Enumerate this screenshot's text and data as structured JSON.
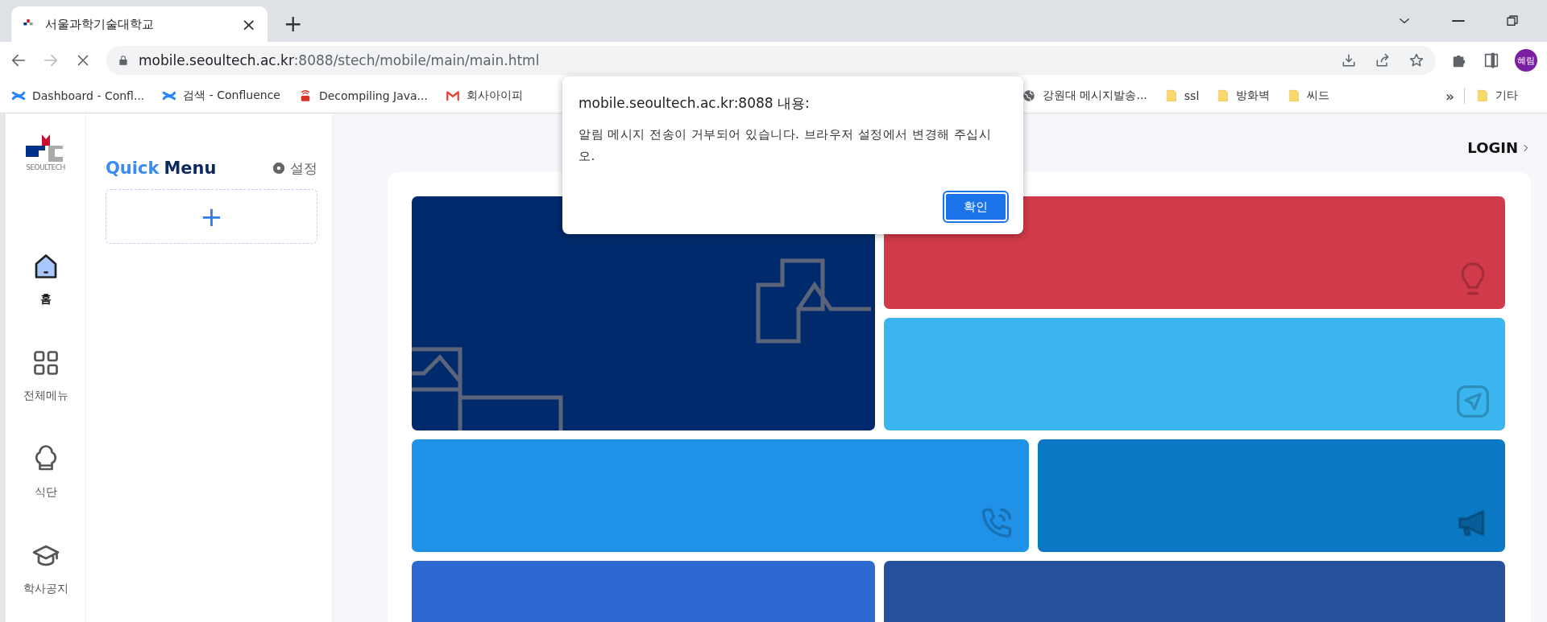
{
  "browser": {
    "tab": {
      "title": "서울과학기술대학교",
      "close": "×"
    },
    "new_tab": "+",
    "address": {
      "host": "mobile.seoultech.ac.kr",
      "path": ":8088/stech/mobile/main/main.html"
    },
    "profile": "혜림",
    "bookmarks_left": [
      {
        "label": "Dashboard - Confl...",
        "kind": "confluence"
      },
      {
        "label": "검색 - Confluence",
        "kind": "confluence"
      },
      {
        "label": "Decompiling Java...",
        "kind": "app"
      },
      {
        "label": "회사아이피",
        "kind": "mail"
      }
    ],
    "bookmarks_right": [
      {
        "label": "강원대 메시지발송...",
        "kind": "globe"
      },
      {
        "label": "ssl",
        "kind": "folder"
      },
      {
        "label": "방화벽",
        "kind": "folder"
      },
      {
        "label": "씨드",
        "kind": "folder"
      }
    ],
    "more": "»",
    "other_bookmarks": {
      "label": "기타",
      "kind": "folder"
    }
  },
  "logo": {
    "text": "SEOULTECH"
  },
  "nav": [
    {
      "label": "홈",
      "kind": "home",
      "selected": true
    },
    {
      "label": "전체메뉴",
      "kind": "grid",
      "selected": false
    },
    {
      "label": "식단",
      "kind": "chef",
      "selected": false
    },
    {
      "label": "학사공지",
      "kind": "cap",
      "selected": false
    }
  ],
  "quick_menu": {
    "title_accent": "Quick",
    "title": "Menu",
    "settings": "설정",
    "add": "+"
  },
  "login": "LOGIN",
  "tiles": [
    {
      "color": "#012a6c",
      "kind": "pattern"
    },
    {
      "color": "#d13a4a",
      "kind": "bulb"
    },
    {
      "color": "#3bb5ef",
      "kind": "plane"
    },
    {
      "color": "#1f91e6",
      "kind": "phone"
    },
    {
      "color": "#0a78c2",
      "kind": "megaphone"
    },
    {
      "color": "#2c69d0",
      "kind": "none"
    },
    {
      "color": "#264f9e",
      "kind": "none"
    }
  ],
  "dialog": {
    "title": "mobile.seoultech.ac.kr:8088 내용:",
    "message": "알림 메시지 전송이 거부되어 있습니다. 브라우저 설정에서 변경해 주십시오.",
    "button": "확인"
  }
}
